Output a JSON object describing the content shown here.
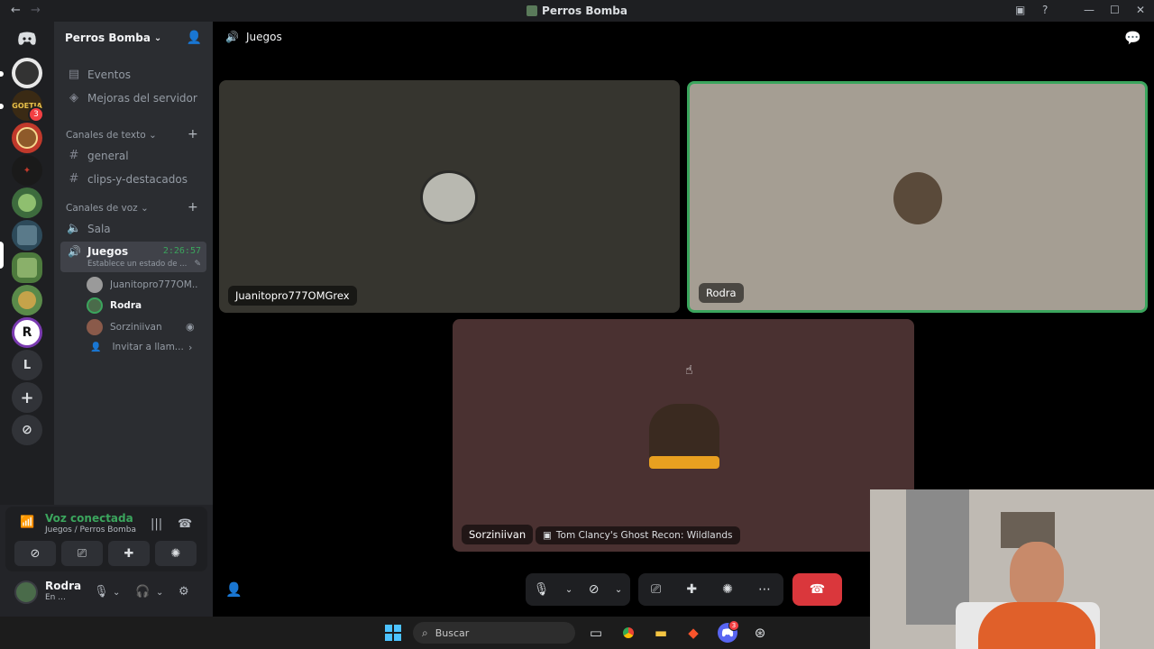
{
  "window": {
    "title": "Perros Bomba"
  },
  "rail": {
    "letter_server": "L",
    "letter_r": "R",
    "badge_count": "3"
  },
  "sidebar": {
    "server_name": "Perros Bomba",
    "top_items": [
      {
        "label": "Eventos",
        "icon": "calendar-icon"
      },
      {
        "label": "Mejoras del servidor",
        "icon": "boost-icon"
      }
    ],
    "text_category": "Canales de texto",
    "text_channels": [
      "general",
      "clips-y-destacados"
    ],
    "voice_category": "Canales de voz",
    "voice_channels": [
      "Sala"
    ],
    "active_channel": {
      "name": "Juegos",
      "timer": "2:26:57",
      "status": "Establece un estado de ..."
    },
    "members": [
      {
        "name": "Juanitopro777OM..."
      },
      {
        "name": "Rodra"
      },
      {
        "name": "Sorziniivan"
      }
    ],
    "invite_label": "Invitar a llam..."
  },
  "voice_panel": {
    "title": "Voz conectada",
    "subtitle": "Juegos / Perros Bomba"
  },
  "user": {
    "name": "Rodra",
    "status": "En ..."
  },
  "stage": {
    "channel_title": "Juegos",
    "tiles": [
      {
        "name": "Juanitopro777OMGrex"
      },
      {
        "name": "Rodra"
      },
      {
        "name": "Sorziniivan",
        "activity": "Tom Clancy's Ghost Recon: Wildlands"
      }
    ]
  },
  "taskbar": {
    "search_label": "Buscar",
    "discord_badge": "3"
  },
  "colors": {
    "accent_green": "#3ba55d",
    "hangup_red": "#da373c",
    "speaking_border": "#3ba55d"
  }
}
